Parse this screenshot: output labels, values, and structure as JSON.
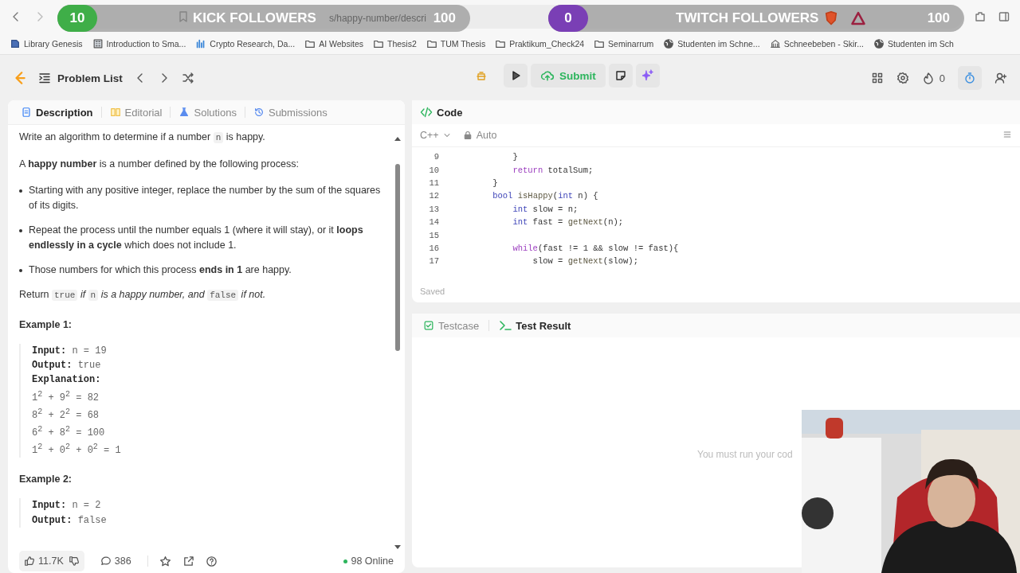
{
  "browser": {
    "url": "s/happy-number/descri"
  },
  "overlays": [
    {
      "kind": "kick",
      "count": "10",
      "title": "KICK FOLLOWERS",
      "goal": "100"
    },
    {
      "kind": "twitch",
      "count": "0",
      "title": "TWITCH FOLLOWERS",
      "goal": "100"
    }
  ],
  "bookmarks": [
    {
      "label": "Library Genesis",
      "kind": "book"
    },
    {
      "label": "Introduction to Sma...",
      "kind": "doc"
    },
    {
      "label": "Crypto Research, Da...",
      "kind": "chart"
    },
    {
      "label": "AI Websites",
      "kind": "folder"
    },
    {
      "label": "Thesis2",
      "kind": "folder"
    },
    {
      "label": "TUM Thesis",
      "kind": "folder"
    },
    {
      "label": "Praktikum_Check24",
      "kind": "folder"
    },
    {
      "label": "Seminarrum",
      "kind": "folder"
    },
    {
      "label": "Studenten im Schne...",
      "kind": "globe"
    },
    {
      "label": "Schneebeben - Skir...",
      "kind": "building"
    },
    {
      "label": "Studenten im Sch",
      "kind": "globe"
    }
  ],
  "toolbar": {
    "problem_list": "Problem List",
    "submit": "Submit",
    "streak": "0"
  },
  "description": {
    "tabs": [
      {
        "label": "Description",
        "kind": "doc",
        "selected": true
      },
      {
        "label": "Editorial",
        "kind": "book",
        "selected": false
      },
      {
        "label": "Solutions",
        "kind": "flask",
        "selected": false
      },
      {
        "label": "Submissions",
        "kind": "history",
        "selected": false
      }
    ],
    "blocks": [
      {
        "kind": "paragraph",
        "segments": [
          {
            "kind": "plain",
            "text": "Write an algorithm to determine if a number "
          },
          {
            "kind": "code",
            "text": "n"
          },
          {
            "kind": "plain",
            "text": " is happy."
          }
        ]
      },
      {
        "kind": "paragraph",
        "segments": [
          {
            "kind": "plain",
            "text": "A "
          },
          {
            "kind": "bold",
            "text": "happy number"
          },
          {
            "kind": "plain",
            "text": " is a number defined by the following process:"
          }
        ]
      },
      {
        "kind": "bullet",
        "segments": [
          {
            "kind": "plain",
            "text": "Starting with any positive integer, replace the number by the sum of the squares of its digits."
          }
        ]
      },
      {
        "kind": "bullet",
        "segments": [
          {
            "kind": "plain",
            "text": "Repeat the process until the number equals 1 (where it will stay), or it "
          },
          {
            "kind": "bold",
            "text": "loops endlessly in a cycle"
          },
          {
            "kind": "plain",
            "text": " which does not include 1."
          }
        ]
      },
      {
        "kind": "bullet",
        "segments": [
          {
            "kind": "plain",
            "text": "Those numbers for which this process "
          },
          {
            "kind": "bold",
            "text": "ends in 1"
          },
          {
            "kind": "plain",
            "text": " are happy."
          }
        ]
      },
      {
        "kind": "paragraph",
        "segments": [
          {
            "kind": "plain",
            "text": "Return "
          },
          {
            "kind": "code",
            "text": "true"
          },
          {
            "kind": "italic",
            "text": " if "
          },
          {
            "kind": "code",
            "text": "n"
          },
          {
            "kind": "italic",
            "text": " is a happy number, and "
          },
          {
            "kind": "code",
            "text": "false"
          },
          {
            "kind": "italic",
            "text": " if not."
          }
        ]
      }
    ],
    "examples": [
      {
        "title": "Example 1:",
        "lines": [
          {
            "kind": "field",
            "label": "Input:",
            "value": "n = 19"
          },
          {
            "kind": "field",
            "label": "Output:",
            "value": "true"
          },
          {
            "kind": "heading",
            "label": "Explanation:"
          },
          {
            "kind": "math",
            "text": "1$^{2}$ + 9$^{2}$ = 82"
          },
          {
            "kind": "math",
            "text": "8$^{2}$ + 2$^{2}$ = 68"
          },
          {
            "kind": "math",
            "text": "6$^{2}$ + 8$^{2}$ = 100"
          },
          {
            "kind": "math",
            "text": "1$^{2}$ + 0$^{2}$ + 0$^{2}$ = 1"
          }
        ]
      },
      {
        "title": "Example 2:",
        "lines": [
          {
            "kind": "field",
            "label": "Input:",
            "value": "n = 2"
          },
          {
            "kind": "field",
            "label": "Output:",
            "value": "false"
          }
        ]
      }
    ],
    "footer": {
      "likes": "11.7K",
      "comments": "386",
      "online": "98 Online"
    }
  },
  "code": {
    "title": "Code",
    "language": "C++",
    "mode": "Auto",
    "status": "Saved",
    "lines": [
      {
        "number": "9",
        "tokens": [
          {
            "kind": "plain",
            "text": "        }"
          }
        ]
      },
      {
        "number": "10",
        "tokens": [
          {
            "kind": "control",
            "text": "        return"
          },
          {
            "kind": "plain",
            "text": " totalSum;"
          }
        ]
      },
      {
        "number": "11",
        "tokens": [
          {
            "kind": "plain",
            "text": "    }"
          }
        ]
      },
      {
        "number": "12",
        "tokens": [
          {
            "kind": "keyword",
            "text": "    bool"
          },
          {
            "kind": "function",
            "text": " isHappy"
          },
          {
            "kind": "plain",
            "text": "("
          },
          {
            "kind": "keyword",
            "text": "int"
          },
          {
            "kind": "plain",
            "text": " n) {"
          }
        ]
      },
      {
        "number": "13",
        "tokens": [
          {
            "kind": "keyword",
            "text": "        int"
          },
          {
            "kind": "plain",
            "text": " slow = n;"
          }
        ]
      },
      {
        "number": "14",
        "tokens": [
          {
            "kind": "keyword",
            "text": "        int"
          },
          {
            "kind": "plain",
            "text": " fast = "
          },
          {
            "kind": "function",
            "text": "getNext"
          },
          {
            "kind": "plain",
            "text": "(n);"
          }
        ]
      },
      {
        "number": "15"
      },
      {
        "number": "16",
        "tokens": [
          {
            "kind": "control",
            "text": "        while"
          },
          {
            "kind": "plain",
            "text": "(fast != 1 && slow != fast){"
          }
        ]
      },
      {
        "number": "17",
        "tokens": [
          {
            "kind": "plain",
            "text": "            slow = "
          },
          {
            "kind": "function",
            "text": "getNext"
          },
          {
            "kind": "plain",
            "text": "(slow);"
          }
        ]
      }
    ]
  },
  "test": {
    "tabs": [
      {
        "label": "Testcase",
        "kind": "check",
        "selected": false
      },
      {
        "label": "Test Result",
        "kind": "prompt",
        "selected": true
      }
    ],
    "message": "You must run your cod"
  }
}
